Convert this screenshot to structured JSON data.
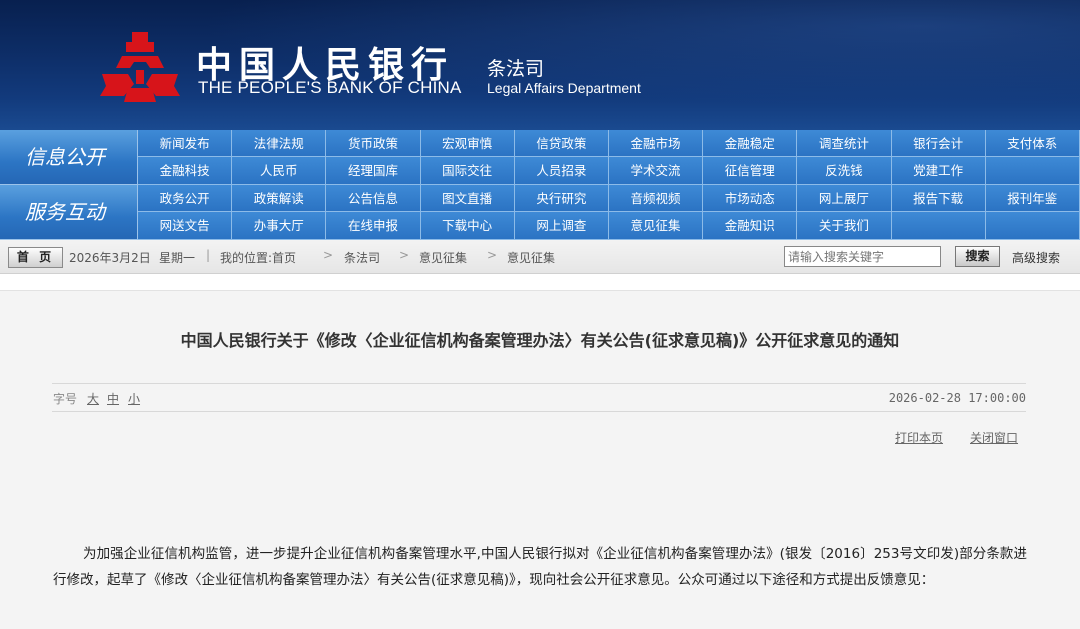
{
  "header": {
    "org_cn": "中国人民银行",
    "org_en": "THE PEOPLE'S BANK OF CHINA",
    "dept_cn": "条法司",
    "dept_en": "Legal Affairs Department",
    "emblem_icon": "pboc-emblem-icon",
    "emblem_color": "#d7141a"
  },
  "nav": {
    "section1_label": "信息公开",
    "section1_items": [
      "新闻发布",
      "法律法规",
      "货币政策",
      "宏观审慎",
      "信贷政策",
      "金融市场",
      "金融稳定",
      "调查统计",
      "银行会计",
      "支付体系",
      "金融科技",
      "人民币",
      "经理国库",
      "国际交往",
      "人员招录",
      "学术交流",
      "征信管理",
      "反洗钱",
      "党建工作",
      ""
    ],
    "section2_label": "服务互动",
    "section2_items": [
      "政务公开",
      "政策解读",
      "公告信息",
      "图文直播",
      "央行研究",
      "音频视频",
      "市场动态",
      "网上展厅",
      "报告下载",
      "报刊年鉴",
      "网送文告",
      "办事大厅",
      "在线申报",
      "下载中心",
      "网上调查",
      "意见征集",
      "金融知识",
      "关于我们",
      "",
      ""
    ]
  },
  "crumbbar": {
    "home": "首 页",
    "date": "2026年3月2日",
    "weekday": "星期一",
    "location_label": "我的位置:首页",
    "crumbs": [
      "条法司",
      "意见征集",
      "意见征集"
    ],
    "search_placeholder": "请输入搜索关键字",
    "search_button": "搜索",
    "advanced_search": "高级搜索"
  },
  "article": {
    "title": "中国人民银行关于《修改〈企业征信机构备案管理办法〉有关公告(征求意见稿)》公开征求意见的通知",
    "font_size_label": "字号",
    "font_large": "大",
    "font_medium": "中",
    "font_small": "小",
    "date": "2026-02-28 17:00:00",
    "print": "打印本页",
    "close": "关闭窗口",
    "body": "为加强企业征信机构监管，进一步提升企业征信机构备案管理水平,中国人民银行拟对《企业征信机构备案管理办法》(银发〔2016〕253号文印发)部分条款进行修改，起草了《修改〈企业征信机构备案管理办法〉有关公告(征求意见稿)》，现向社会公开征求意见。公众可通过以下途径和方式提出反馈意见："
  }
}
